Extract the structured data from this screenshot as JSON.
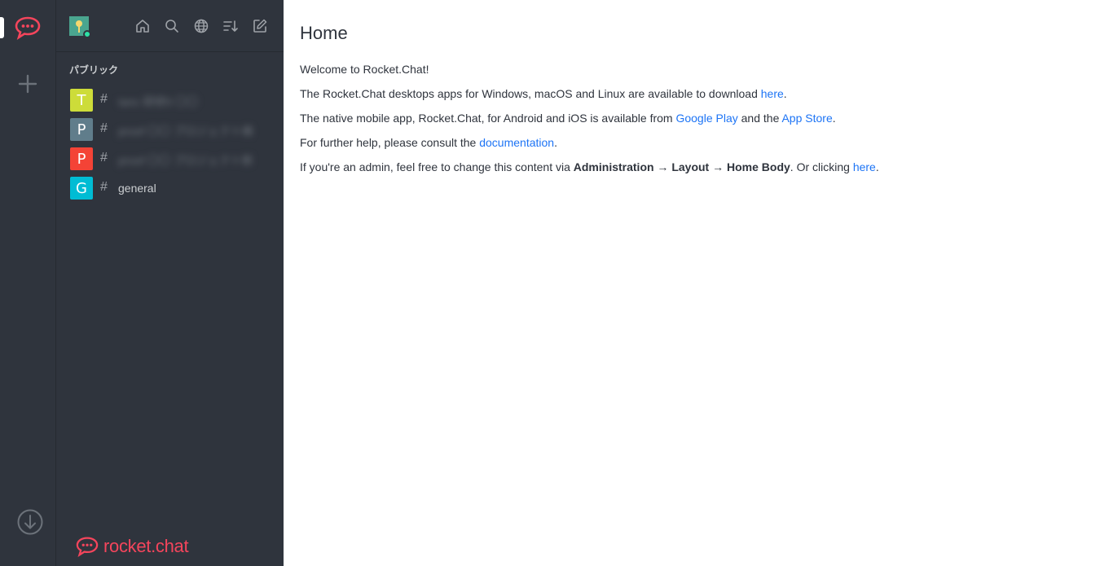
{
  "sidebar": {
    "section_title": "パブリック",
    "rooms": [
      {
        "initial": "T",
        "color": "#cddc39",
        "name": "tanc 研修5 〇〇",
        "blurred": true
      },
      {
        "initial": "P",
        "color": "#607d8b",
        "name": "proof 〇〇 プロジェクト検",
        "blurred": true
      },
      {
        "initial": "P",
        "color": "#f44336",
        "name": "proof 〇〇 プロジェクト新",
        "blurred": true
      },
      {
        "initial": "G",
        "color": "#00bcd4",
        "name": "general",
        "blurred": false
      }
    ],
    "brand_text": "rocket.chat"
  },
  "main": {
    "title": "Home",
    "welcome": "Welcome to Rocket.Chat!",
    "desktop_prefix": "The Rocket.Chat desktops apps for Windows, macOS and Linux are available to download ",
    "desktop_link": "here",
    "desktop_suffix": ".",
    "mobile_prefix": "The native mobile app, Rocket.Chat, for Android and iOS is available from ",
    "mobile_link1": "Google Play",
    "mobile_mid": " and the ",
    "mobile_link2": "App Store",
    "mobile_suffix": ".",
    "help_prefix": "For further help, please consult the ",
    "help_link": "documentation",
    "help_suffix": ".",
    "admin_prefix": "If you're an admin, feel free to change this content via ",
    "admin_bold1": "Administration",
    "admin_arrow1": " → ",
    "admin_bold2": "Layout",
    "admin_arrow2": " → ",
    "admin_bold3": "Home Body",
    "admin_mid": ". Or clicking ",
    "admin_link": "here",
    "admin_suffix": "."
  },
  "colors": {
    "brand": "#f5455c",
    "link": "#1d74f5",
    "sidebar_bg": "#2f343d"
  }
}
